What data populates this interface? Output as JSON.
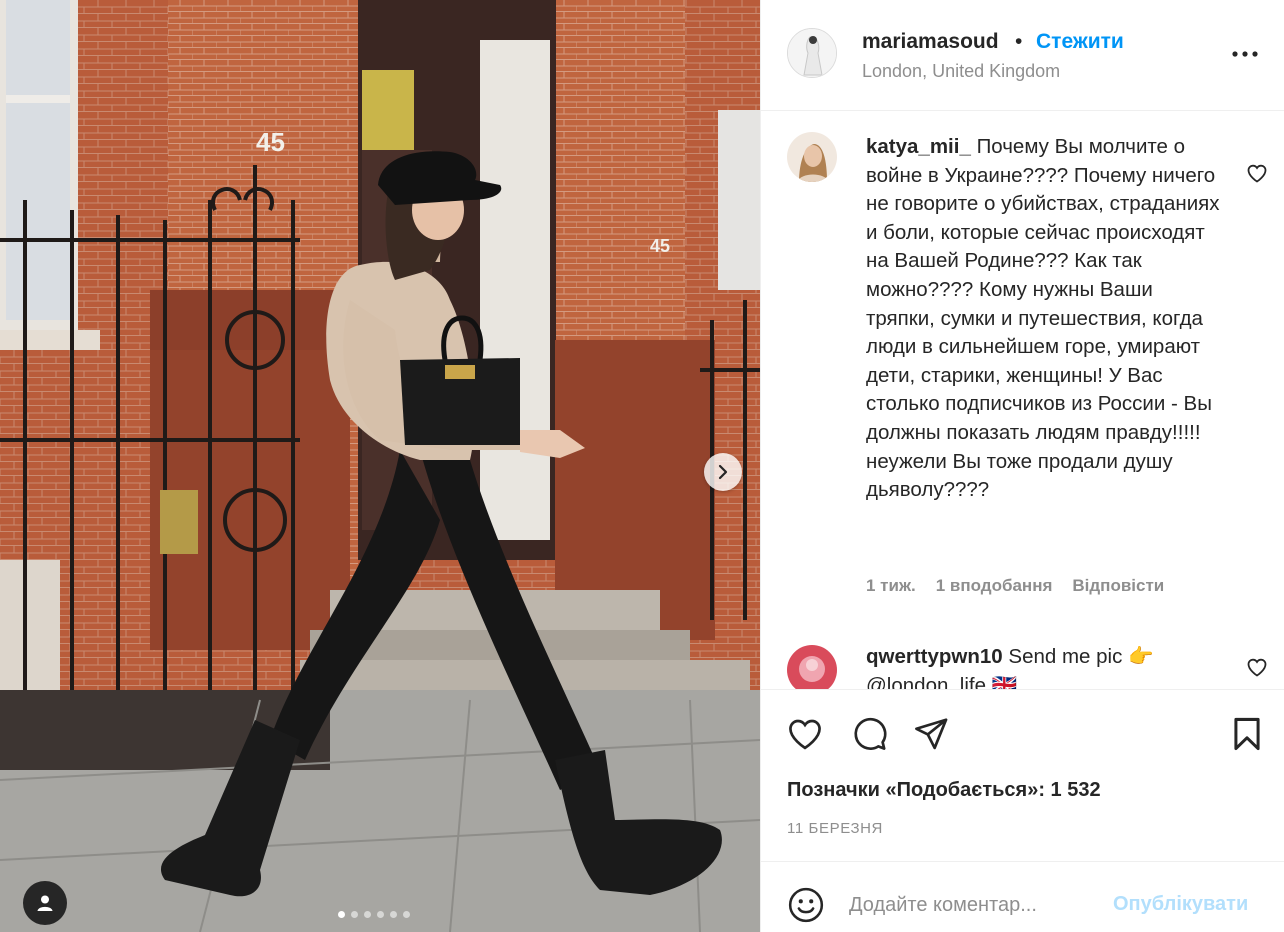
{
  "post": {
    "image_alt": "Woman walking past red brick building",
    "carousel": {
      "count": 6,
      "active_index": 0
    },
    "door_number": "45",
    "door_number_side": "45"
  },
  "header": {
    "username": "mariamasoud",
    "separator": "•",
    "follow_label": "Стежити",
    "location": "London, United Kingdom",
    "more_icon": "more-horizontal-icon"
  },
  "comments": [
    {
      "username": "katya_mii_",
      "text": "Почему Вы молчите о войне в Украине???? Почему ничего не говорите о убийствах, страданиях и боли, которые сейчас происходят на Вашей Родине??? Как так можно???? Кому нужны Ваши тряпки, сумки и путешествия, когда люди в сильнейшем горе, умирают дети, старики, женщины! У Вас столько подписчиков из России - Вы должны показать людям правду!!!!! неужели Вы тоже продали душу дьяволу????",
      "time": "1 тиж.",
      "likes": "1 вподобання",
      "reply": "Відповісти"
    },
    {
      "username": "qwerttypwn10",
      "text": "Send me pic 👉 @london_life 🇬🇧"
    }
  ],
  "actions": {
    "like_icon": "heart-icon",
    "comment_icon": "comment-icon",
    "share_icon": "send-icon",
    "save_icon": "bookmark-icon",
    "likes_text": "Позначки «Подобається»: 1 532",
    "date": "11 БЕРЕЗНЯ"
  },
  "add_comment": {
    "emoji_icon": "emoji-icon",
    "placeholder": "Додайте коментар...",
    "publish_label": "Опублікувати"
  },
  "colors": {
    "accent": "#0095f6",
    "publish_disabled": "#b2dffc",
    "muted": "#8e8e8e",
    "text": "#262626"
  }
}
